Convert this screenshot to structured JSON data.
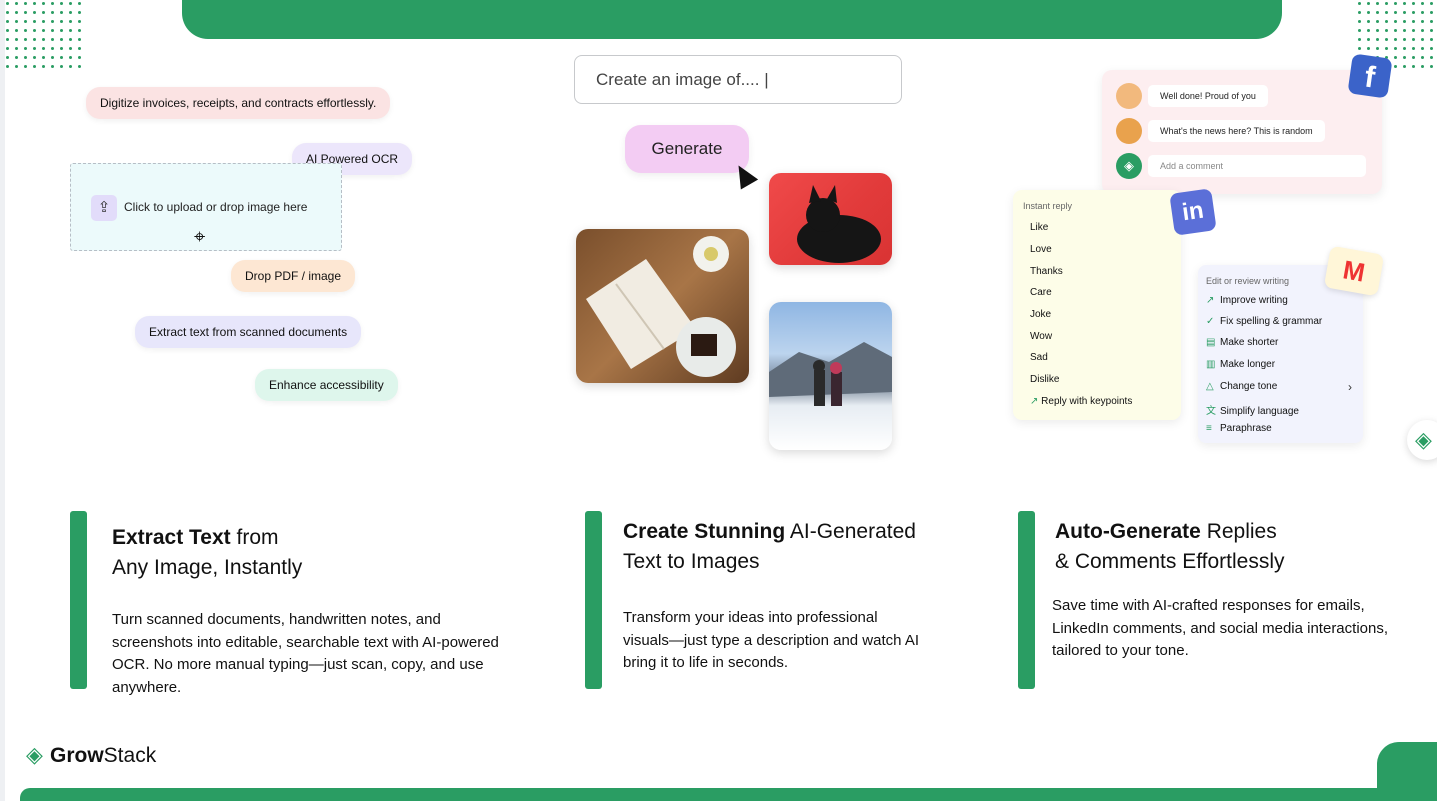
{
  "ocr": {
    "chip_digitize": "Digitize invoices, receipts, and contracts effortlessly.",
    "chip_ai_ocr": "AI Powered OCR",
    "upload_icon": "upload-icon",
    "upload_text": "Click to upload or drop image here",
    "chip_drop": "Drop PDF / image",
    "chip_extract": "Extract text from scanned documents",
    "chip_enhance": "Enhance accessibility"
  },
  "image_gen": {
    "prompt_text": "Create an image of.... |",
    "generate_label": "Generate"
  },
  "social": {
    "comments": [
      {
        "text": "Well done! Proud of you"
      },
      {
        "text": "What's the news here? This is random"
      }
    ],
    "add_comment_placeholder": "Add a comment",
    "instant_reply_heading": "Instant reply",
    "instant_replies": [
      "Like",
      "Love",
      "Thanks",
      "Care",
      "Joke",
      "Wow",
      "Sad",
      "Dislike",
      "Reply with keypoints"
    ],
    "edit_heading": "Edit or review writing",
    "edit_items": [
      "Improve writing",
      "Fix spelling & grammar",
      "Make shorter",
      "Make longer",
      "Change tone",
      "Simplify language",
      "Paraphrase"
    ]
  },
  "features": [
    {
      "title_bold": "Extract Text",
      "title_rest_1": " from",
      "title_line_2": "Any Image, Instantly",
      "description": "Turn scanned documents, handwritten notes, and screenshots into editable, searchable text with AI-powered OCR. No more manual typing—just scan, copy, and use anywhere."
    },
    {
      "title_bold": "Create Stunning",
      "title_rest_1": " AI-Generated",
      "title_line_2": "Text to Images",
      "description": "Transform your ideas into professional visuals—just type a description and watch AI bring it to life in seconds."
    },
    {
      "title_bold": "Auto-Generate",
      "title_rest_1": " Replies",
      "title_line_2": "& Comments Effortlessly",
      "description": "Save time with AI-crafted responses for emails, LinkedIn comments, and social media interactions, tailored to your tone."
    }
  ],
  "brand": {
    "name_bold": "Grow",
    "name_rest": "Stack",
    "accent_color": "#2a9d63"
  }
}
